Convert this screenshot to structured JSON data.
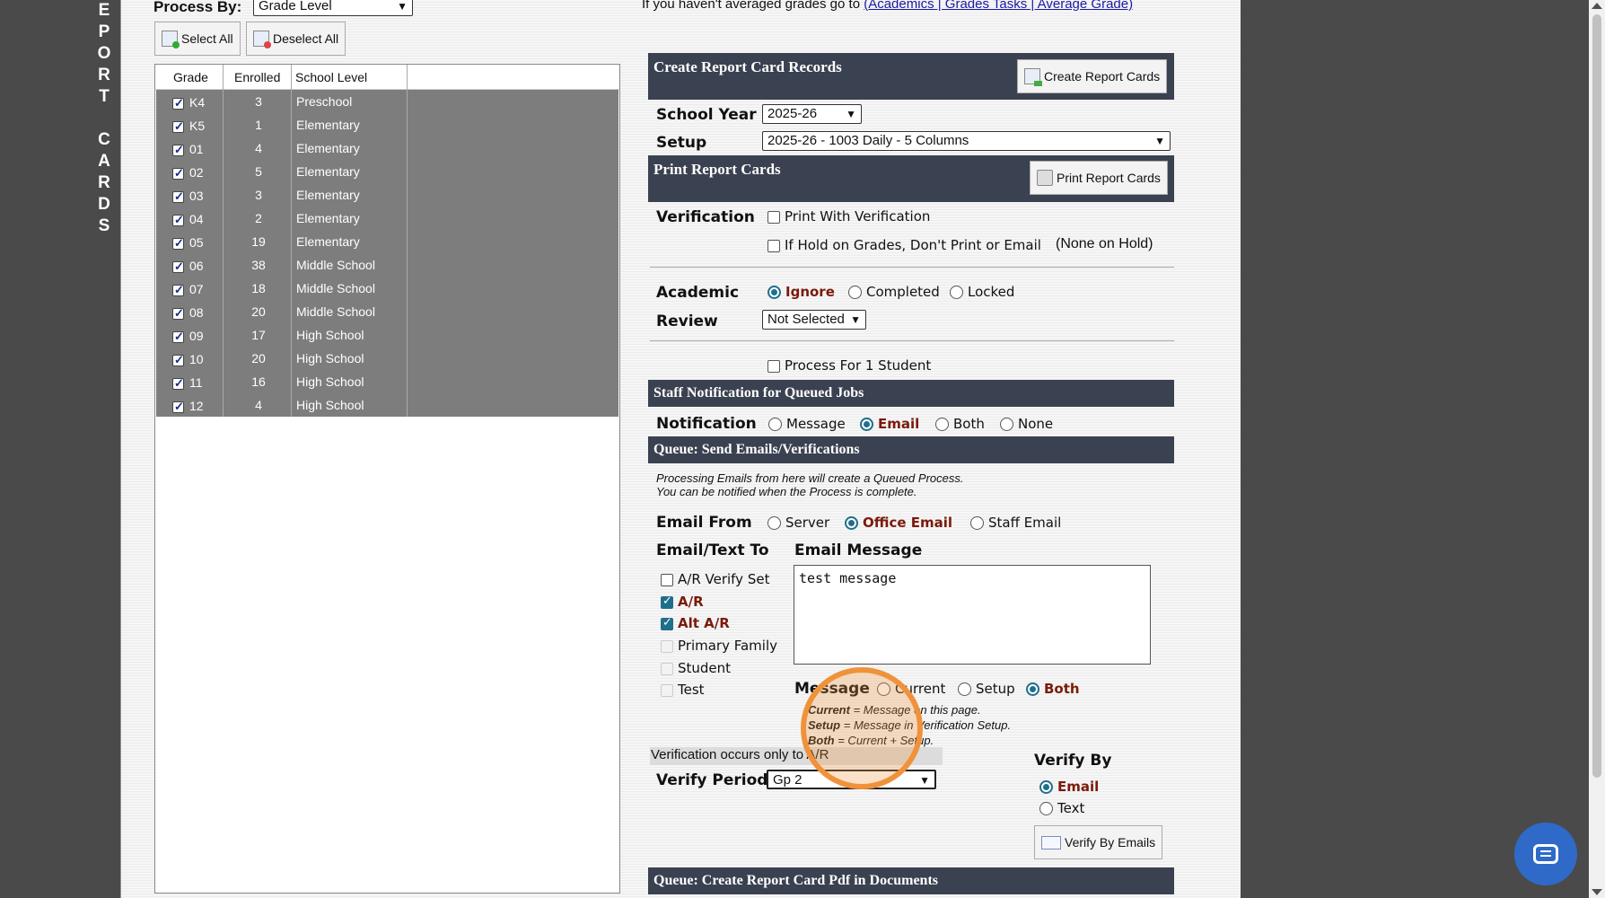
{
  "sidebar": {
    "title_letters_1": [
      "E",
      "P",
      "O",
      "R",
      "T"
    ],
    "title_letters_2": [
      "C",
      "A",
      "R",
      "D",
      "S"
    ]
  },
  "top": {
    "process_by_label": "Process By:",
    "process_by_value": "Grade Level",
    "avg_note_prefix": "If you haven't averaged grades go to",
    "avg_link": "(Academics | Grades Tasks | Average Grade)",
    "select_all": "Select All",
    "deselect_all": "Deselect All"
  },
  "grade_table": {
    "headers": {
      "grade": "Grade",
      "enrolled": "Enrolled",
      "level": "School Level"
    },
    "rows": [
      {
        "grade": "K4",
        "enrolled": "3",
        "level": "Preschool"
      },
      {
        "grade": "K5",
        "enrolled": "1",
        "level": "Elementary"
      },
      {
        "grade": "01",
        "enrolled": "4",
        "level": "Elementary"
      },
      {
        "grade": "02",
        "enrolled": "5",
        "level": "Elementary"
      },
      {
        "grade": "03",
        "enrolled": "3",
        "level": "Elementary"
      },
      {
        "grade": "04",
        "enrolled": "2",
        "level": "Elementary"
      },
      {
        "grade": "05",
        "enrolled": "19",
        "level": "Elementary"
      },
      {
        "grade": "06",
        "enrolled": "38",
        "level": "Middle School"
      },
      {
        "grade": "07",
        "enrolled": "18",
        "level": "Middle School"
      },
      {
        "grade": "08",
        "enrolled": "20",
        "level": "Middle School"
      },
      {
        "grade": "09",
        "enrolled": "17",
        "level": "High School"
      },
      {
        "grade": "10",
        "enrolled": "20",
        "level": "High School"
      },
      {
        "grade": "11",
        "enrolled": "16",
        "level": "High School"
      },
      {
        "grade": "12",
        "enrolled": "4",
        "level": "High School"
      }
    ]
  },
  "create": {
    "title": "Create Report Card Records",
    "button": "Create Report Cards",
    "school_year_label": "School Year",
    "school_year_value": "2025-26",
    "setup_label": "Setup",
    "setup_value": "2025-26 - 1003 Daily - 5 Columns"
  },
  "print": {
    "title": "Print Report Cards",
    "button": "Print Report Cards",
    "verification_label": "Verification",
    "print_with_verification": "Print With Verification",
    "hold_option": "If Hold on Grades, Don't Print or Email",
    "hold_status": "(None on Hold)",
    "academic_label": "Academic",
    "review_label": "Review",
    "academic_options": [
      "Ignore",
      "Completed",
      "Locked"
    ],
    "review_value": "Not Selected",
    "process_one": "Process For 1 Student"
  },
  "staff_notification": {
    "title": "Staff Notification for Queued Jobs",
    "label": "Notification",
    "options": [
      "Message",
      "Email",
      "Both",
      "None"
    ]
  },
  "queue_email": {
    "title": "Queue: Send Emails/Verifications",
    "note_line1": "Processing Emails from here will create a Queued Process.",
    "note_line2": "You can be notified when the Process is complete.",
    "email_from_label": "Email From",
    "email_from_options": [
      "Server",
      "Office Email",
      "Staff Email"
    ],
    "to_label": "Email/Text To",
    "message_label": "Email Message",
    "recipients": [
      "A/R Verify Set",
      "A/R",
      "Alt A/R",
      "Primary Family",
      "Student",
      "Test"
    ],
    "message_text": "test message",
    "message_opt_label": "Message",
    "message_options": [
      "Current",
      "Setup",
      "Both"
    ],
    "legend": [
      {
        "key": "Current",
        "text": " = Message on this page."
      },
      {
        "key": "Setup",
        "text": " = Message in Verification Setup."
      },
      {
        "key": "Both",
        "text": " = Current + Setup."
      }
    ],
    "verification_note": "Verification occurs only to A/R",
    "verify_period_label": "Verify Period",
    "verify_period_value": "Gp 2",
    "verify_by_label": "Verify By",
    "verify_by_options": [
      "Email",
      "Text"
    ],
    "verify_button": "Verify By Emails"
  },
  "queue_pdf": {
    "title": "Queue: Create Report Card Pdf in Documents"
  },
  "colors": {
    "section_bar": "#3a4150",
    "accent": "#1f6f8b",
    "selected_text": "#7a1a0a",
    "highlight": "#f0923a",
    "chat": "#2f6ac9"
  }
}
